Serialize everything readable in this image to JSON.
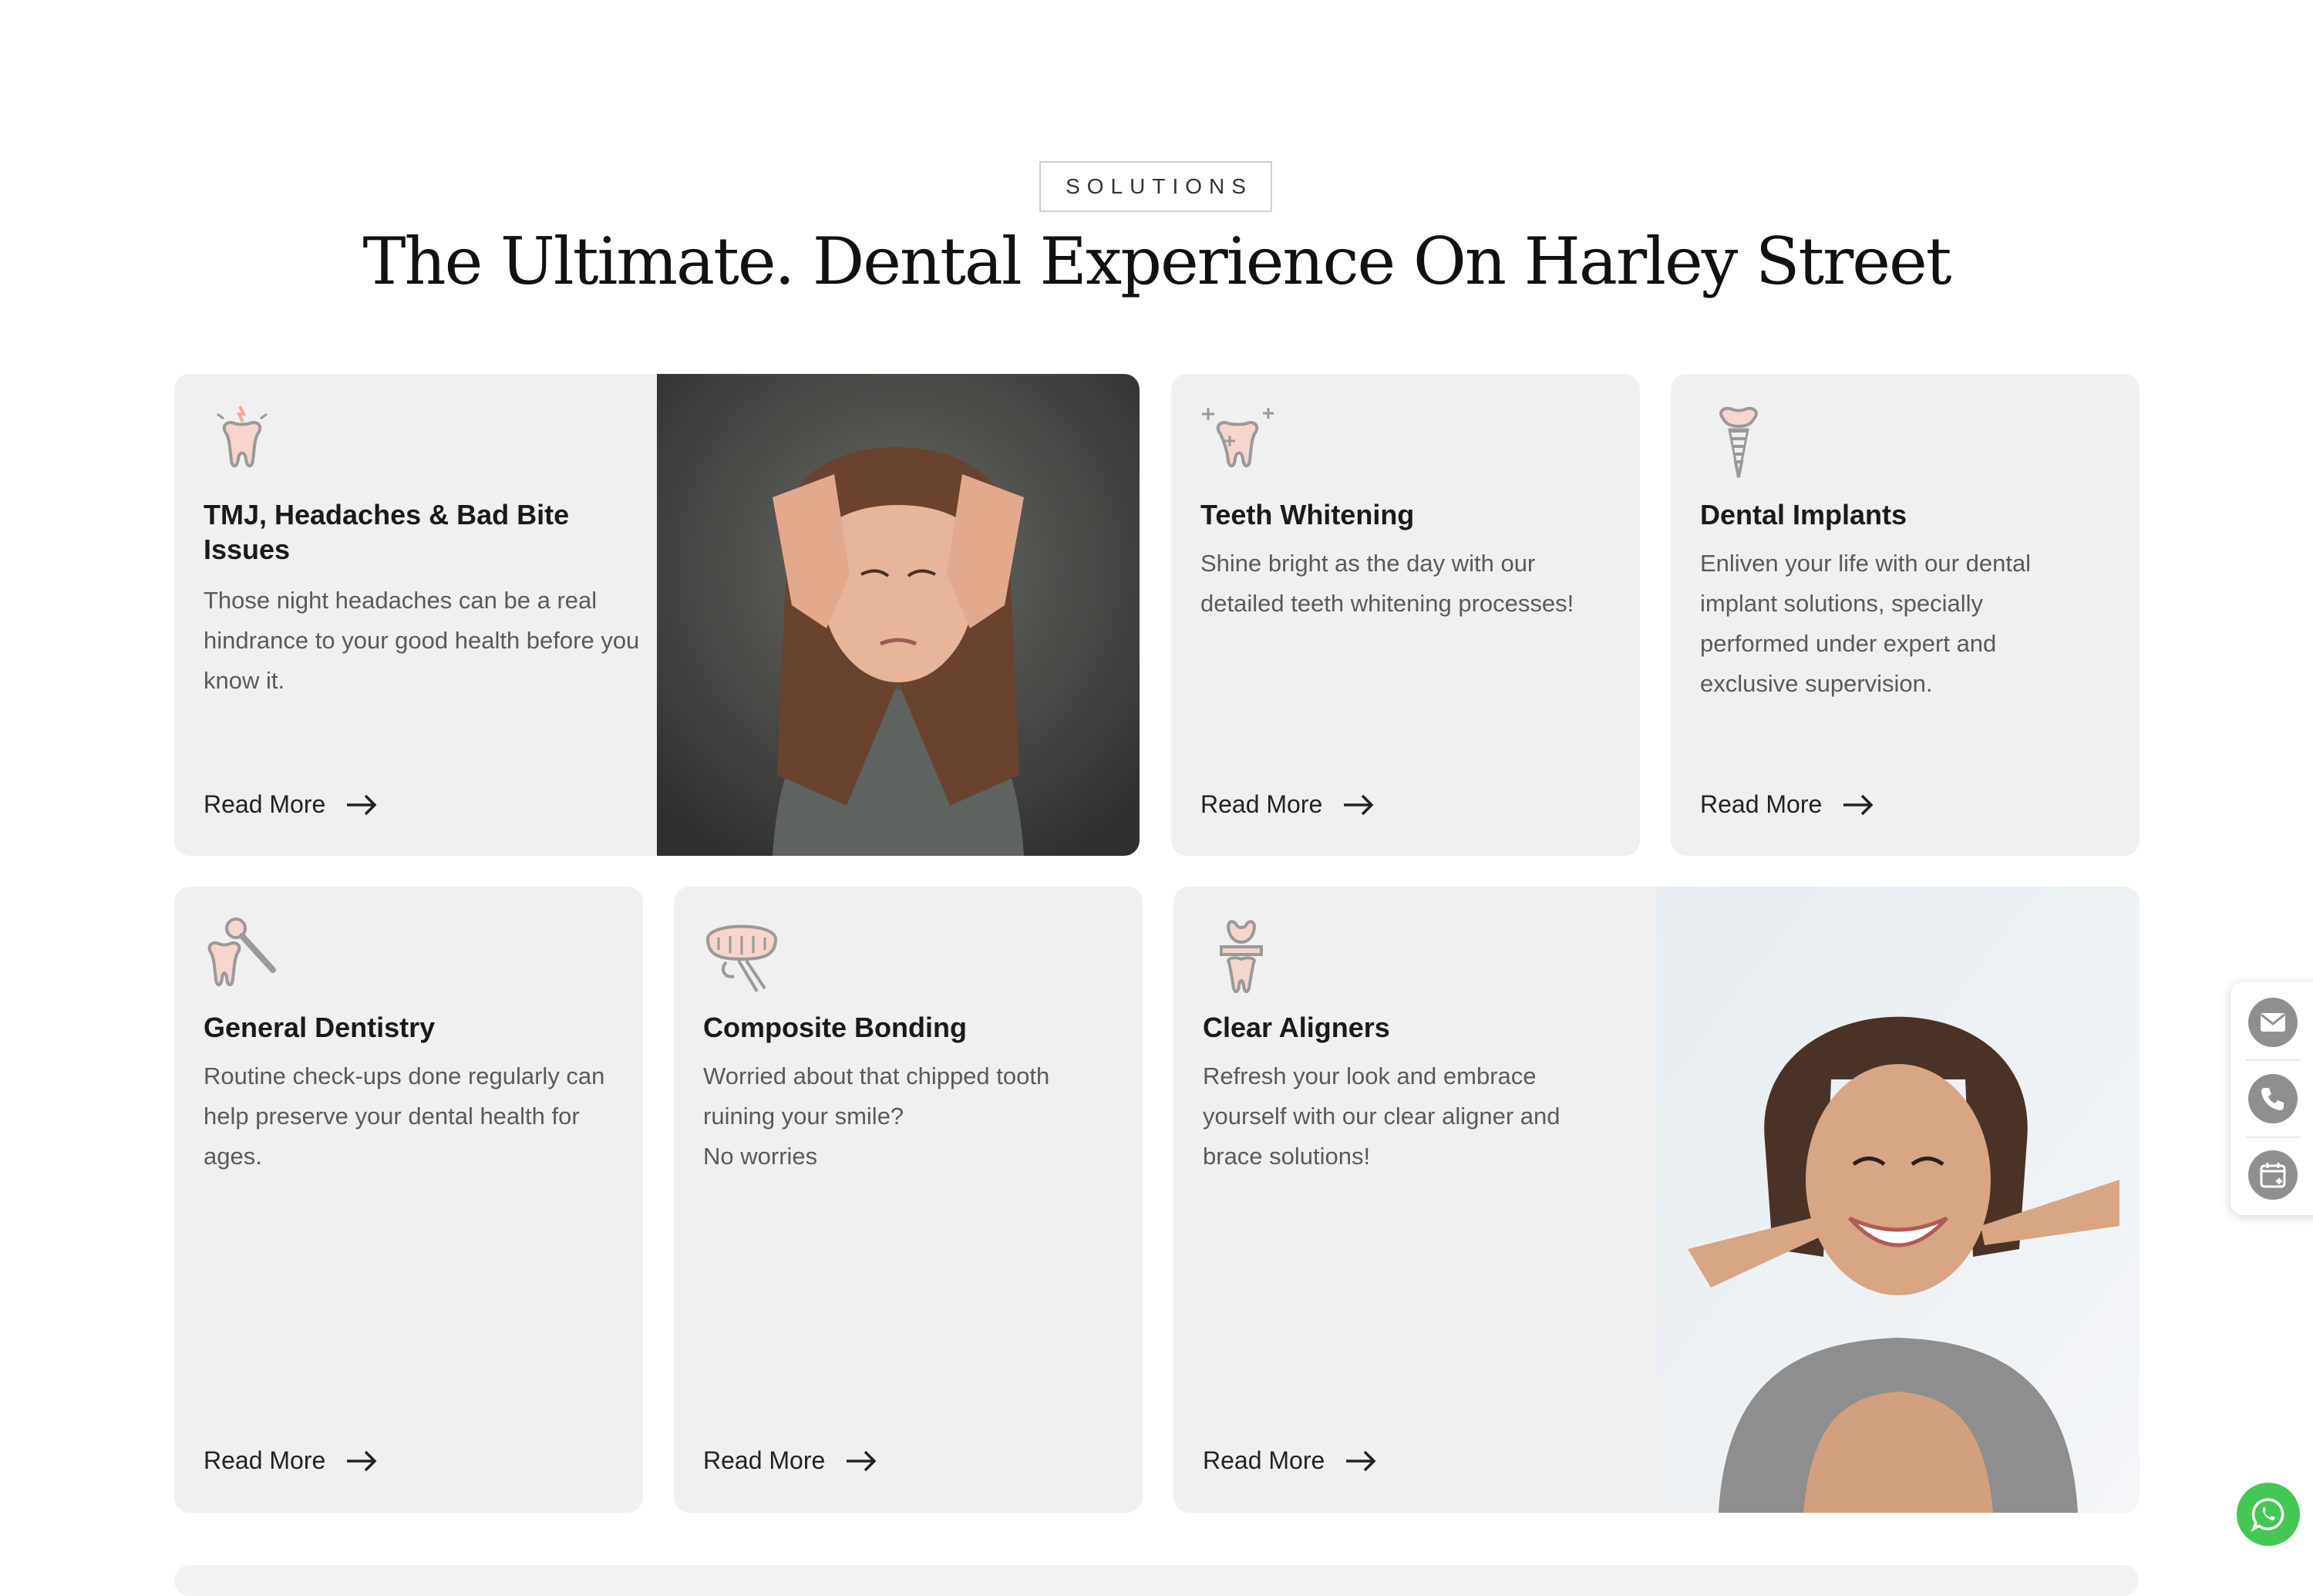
{
  "section": {
    "eyebrow": "SOLUTIONS",
    "headline": "The Ultimate. Dental Experience On Harley Street"
  },
  "cards": [
    {
      "title": "TMJ, Headaches  & Bad Bite Issues",
      "description": "Those night headaches can be a real hindrance to your good health before you know it.",
      "link_label": "Read More",
      "icon": "tooth-pain-icon"
    },
    {
      "title": "Teeth Whitening",
      "description": "Shine bright as the day with  our detailed teeth whitening processes!",
      "link_label": "Read More",
      "icon": "sparkling-tooth-icon"
    },
    {
      "title": "Dental Implants",
      "description": "Enliven your life with our dental implant solutions, specially performed under expert and exclusive supervision.",
      "link_label": "Read More",
      "icon": "dental-implant-icon"
    },
    {
      "title": "General Dentistry",
      "description": "Routine check-ups done regularly can help preserve your dental health for ages.",
      "link_label": "Read More",
      "icon": "tooth-magnifier-icon"
    },
    {
      "title": "Composite Bonding",
      "description": "Worried about that chipped tooth ruining your smile?\nNo worries",
      "link_label": "Read More",
      "icon": "teeth-bonding-icon"
    },
    {
      "title": "Clear Aligners",
      "description": "Refresh your look and embrace yourself with our clear aligner and brace solutions!",
      "link_label": "Read More",
      "icon": "aligner-tooth-icon"
    }
  ],
  "images": {
    "headache_photo": "woman-holding-head-photo",
    "smile_photo": "woman-pointing-at-smile-photo"
  },
  "contact_buttons": [
    "email-icon",
    "phone-icon",
    "calendar-icon"
  ],
  "chat_button": "whatsapp-icon",
  "colors": {
    "card_bg": "#f0f0f0",
    "icon_outline": "#9a9a9a",
    "icon_fill": "#f6d5cd",
    "whatsapp": "#45c755"
  }
}
